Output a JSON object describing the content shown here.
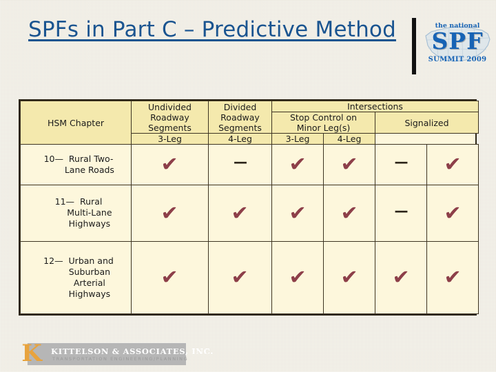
{
  "slide": {
    "title": "SPFs in Part C – Predictive Method",
    "background_color": "#F0EDE2",
    "title_color": "#1A5490"
  },
  "summit_logo": {
    "line1": "the national",
    "line2": "SPF",
    "line3": "SUMMIT 2009",
    "color": "#1763B5"
  },
  "footer_logo": {
    "monogram": "K",
    "company": "KITTELSON & ASSOCIATES, INC.",
    "tagline": "TRANSPORTATION ENGINEERING/PLANNING",
    "monogram_color": "#E8A33D",
    "band_color": "#B6B6B6"
  },
  "table": {
    "header": {
      "chapter": "HSM Chapter",
      "undivided": "Undivided Roadway Segments",
      "undivided_lines": [
        "Undivided",
        "Roadway",
        "Segments"
      ],
      "divided": "Divided Roadway Segments",
      "divided_lines": [
        "Divided",
        "Roadway",
        "Segments"
      ],
      "intersections": "Intersections",
      "stop_control": "Stop Control on Minor Leg(s)",
      "stop_control_lines": [
        "Stop Control on",
        "Minor Leg(s)"
      ],
      "signalized": "Signalized",
      "legs": [
        "3-Leg",
        "4-Leg",
        "3-Leg",
        "4-Leg"
      ]
    },
    "marks": {
      "yes": "✔",
      "no": "—"
    },
    "mark_colors": {
      "yes": "#8D3F49",
      "no": "#2A2318"
    },
    "header_bg": "#F4E9AD",
    "body_bg": "#FDF7DC",
    "border_color": "#3D3422",
    "rows": [
      {
        "chapter_lines": [
          "10—  Rural Two-",
          "        Lane Roads"
        ],
        "chapter": "10— Rural Two-Lane Roads",
        "cells": [
          "yes",
          "no",
          "yes",
          "yes",
          "no",
          "yes"
        ]
      },
      {
        "chapter_lines": [
          "11—  Rural",
          "        Multi-Lane",
          "        Highways"
        ],
        "chapter": "11— Rural Multi-Lane Highways",
        "cells": [
          "yes",
          "yes",
          "yes",
          "yes",
          "no",
          "yes"
        ]
      },
      {
        "chapter_lines": [
          "12—  Urban and",
          "        Suburban",
          "        Arterial",
          "        Highways"
        ],
        "chapter": "12— Urban and Suburban Arterial Highways",
        "cells": [
          "yes",
          "yes",
          "yes",
          "yes",
          "yes",
          "yes"
        ]
      }
    ]
  }
}
